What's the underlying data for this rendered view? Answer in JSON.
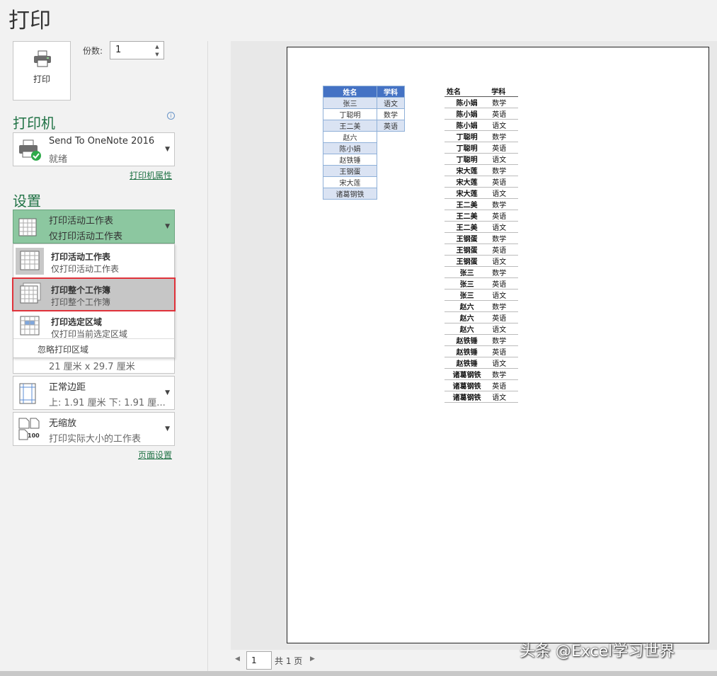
{
  "title": "打印",
  "print_button": {
    "label": "打印"
  },
  "copies": {
    "label": "份数:",
    "value": "1"
  },
  "printer": {
    "section_title": "打印机",
    "name": "Send To OneNote 2016",
    "status": "就绪",
    "properties_link": "打印机属性"
  },
  "settings": {
    "section_title": "设置",
    "selected": {
      "title": "打印活动工作表",
      "subtitle": "仅打印活动工作表"
    },
    "menu": [
      {
        "title": "打印活动工作表",
        "subtitle": "仅打印活动工作表"
      },
      {
        "title": "打印整个工作簿",
        "subtitle": "打印整个工作簿"
      },
      {
        "title": "打印选定区域",
        "subtitle": "仅打印当前选定区域"
      }
    ],
    "ignore_print_area": "忽略打印区域",
    "paper_size": "21 厘米 x 29.7 厘米",
    "margins": {
      "title": "正常边距",
      "subtitle": "上: 1.91 厘米 下: 1.91 厘..."
    },
    "scaling": {
      "title": "无缩放",
      "subtitle": "打印实际大小的工作表",
      "icon_text": "100"
    },
    "page_setup_link": "页面设置"
  },
  "preview": {
    "table1": {
      "headers": [
        "姓名",
        "学科"
      ],
      "names": [
        "张三",
        "丁聪明",
        "王二美",
        "赵六",
        "陈小娟",
        "赵铁锤",
        "王钢蛋",
        "宋大莲",
        "诸葛钢铁"
      ],
      "subjects": [
        "语文",
        "数学",
        "英语"
      ]
    },
    "table2": {
      "headers": [
        "姓名",
        "学科"
      ],
      "rows": [
        [
          "陈小娟",
          "数学"
        ],
        [
          "陈小娟",
          "英语"
        ],
        [
          "陈小娟",
          "语文"
        ],
        [
          "丁聪明",
          "数学"
        ],
        [
          "丁聪明",
          "英语"
        ],
        [
          "丁聪明",
          "语文"
        ],
        [
          "宋大莲",
          "数学"
        ],
        [
          "宋大莲",
          "英语"
        ],
        [
          "宋大莲",
          "语文"
        ],
        [
          "王二美",
          "数学"
        ],
        [
          "王二美",
          "英语"
        ],
        [
          "王二美",
          "语文"
        ],
        [
          "王钢蛋",
          "数学"
        ],
        [
          "王钢蛋",
          "英语"
        ],
        [
          "王钢蛋",
          "语文"
        ],
        [
          "张三",
          "数学"
        ],
        [
          "张三",
          "英语"
        ],
        [
          "张三",
          "语文"
        ],
        [
          "赵六",
          "数学"
        ],
        [
          "赵六",
          "英语"
        ],
        [
          "赵六",
          "语文"
        ],
        [
          "赵铁锤",
          "数学"
        ],
        [
          "赵铁锤",
          "英语"
        ],
        [
          "赵铁锤",
          "语文"
        ],
        [
          "诸葛钢铁",
          "数学"
        ],
        [
          "诸葛钢铁",
          "英语"
        ],
        [
          "诸葛钢铁",
          "语文"
        ]
      ]
    }
  },
  "pager": {
    "current": "1",
    "total": "共 1 页"
  },
  "watermark": "头条 @Excel学习世界",
  "colors": {
    "accent": "#217346",
    "selected_dropdown": "#8cc7a0",
    "highlight_border": "#e0323a",
    "table_header": "#4472c4",
    "table_band": "#dae3f3"
  }
}
